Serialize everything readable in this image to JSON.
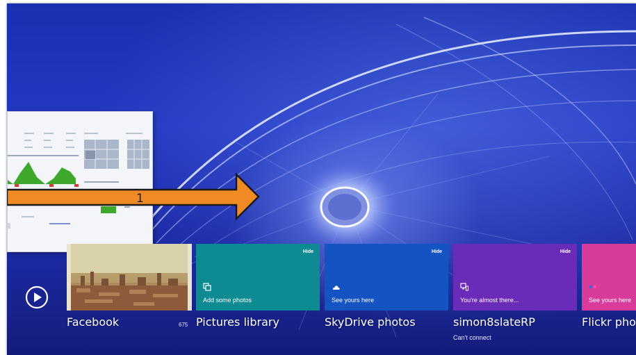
{
  "hub": {
    "facebook": {
      "label": "Facebook",
      "count": "675"
    },
    "tiles": [
      {
        "id": "pictures",
        "caption": "Add some photos",
        "label": "Pictures library",
        "sublabel": "",
        "hide": "Hide",
        "color": "#0e8a92",
        "icon": "copy-icon"
      },
      {
        "id": "skydrive",
        "caption": "See yours here",
        "label": "SkyDrive photos",
        "sublabel": "",
        "hide": "Hide",
        "color": "#1354c2",
        "icon": "cloud-icon"
      },
      {
        "id": "simon",
        "caption": "You're almost there...",
        "label": "simon8slateRP",
        "sublabel": "Can't connect",
        "hide": "Hide",
        "color": "#6a2bb8",
        "icon": "computer-icon"
      },
      {
        "id": "flickr",
        "caption": "See yours here",
        "label": "Flickr pho",
        "sublabel": "",
        "hide": "",
        "color": "#d83b9a",
        "icon": "flickr-icon"
      }
    ]
  },
  "annotation": {
    "label": "1"
  },
  "colors": {
    "arrow_fill": "#f08a24",
    "arrow_stroke": "#1a1a1a"
  }
}
